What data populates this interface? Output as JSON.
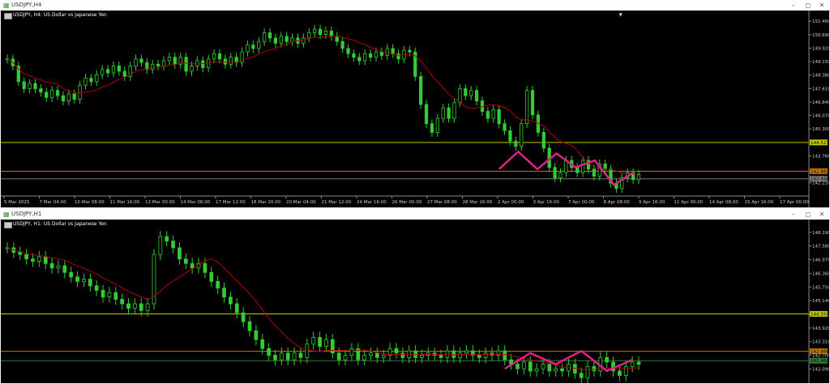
{
  "windows": [
    {
      "title": "USDJPY,H4",
      "chart_title": "USDJPY, H4: US Dollar vs Japanese Yen",
      "chart_data": {
        "type": "candlestick",
        "y_ticks": [
          151.46,
          150.69,
          149.92,
          149.15,
          148.38,
          147.61,
          146.84,
          146.07,
          145.3,
          143.76,
          142.22
        ],
        "ylim": [
          141.6,
          151.7
        ],
        "x_labels": [
          "5 Mar 2025",
          "7 Mar 04:00",
          "10 Mar 08:00",
          "11 Mar 16:00",
          "13 Mar 00:00",
          "14 Mar 08:00",
          "17 Mar 12:00",
          "18 Mar 20:00",
          "20 Mar 04:00",
          "21 Mar 12:00",
          "24 Mar 16:00",
          "26 Mar 00:00",
          "27 Mar 08:00",
          "28 Mar 16:00",
          "2 Apr 00:00",
          "3 Apr 16:00",
          "7 Apr 00:00",
          "8 Apr 08:00",
          "9 Apr 16:00",
          "11 Apr 00:00",
          "14 Apr 08:00",
          "15 Apr 16:00",
          "17 Apr 00:00"
        ],
        "closes": [
          149.3,
          148.9,
          148.0,
          147.6,
          147.9,
          147.6,
          147.4,
          147.1,
          147.5,
          147.2,
          146.9,
          147.3,
          147.0,
          147.8,
          148.2,
          148.0,
          148.4,
          148.7,
          148.5,
          148.9,
          148.6,
          148.3,
          148.9,
          149.3,
          149.1,
          148.7,
          149.0,
          148.9,
          149.2,
          149.4,
          149.0,
          149.4,
          148.6,
          148.9,
          149.2,
          148.8,
          149.3,
          149.6,
          149.3,
          149.0,
          149.4,
          149.1,
          149.7,
          150.1,
          149.9,
          150.3,
          150.8,
          150.5,
          150.2,
          150.6,
          150.3,
          150.5,
          150.2,
          150.5,
          150.8,
          151.0,
          150.7,
          150.9,
          150.6,
          150.3,
          149.9,
          149.6,
          149.4,
          149.2,
          149.6,
          149.4,
          149.7,
          149.5,
          149.9,
          149.6,
          149.3,
          149.8,
          149.7,
          148.3,
          146.7,
          145.6,
          145.1,
          145.9,
          146.5,
          145.9,
          146.8,
          147.6,
          147.2,
          147.5,
          146.9,
          146.3,
          145.9,
          146.4,
          145.6,
          145.2,
          144.6,
          144.3,
          145.6,
          147.5,
          146.1,
          145.1,
          144.2,
          143.1,
          142.5,
          142.8,
          143.5,
          143.1,
          142.8,
          143.5,
          143.0,
          142.6,
          143.3,
          143.0,
          142.2,
          141.9,
          142.5,
          142.8,
          142.4,
          142.7
        ],
        "indicator": "moving average",
        "levels": [
          {
            "label": "144.527",
            "value": 144.527,
            "color": "#c8c800"
          },
          {
            "label": "142.882",
            "value": 142.882,
            "color": "#c87800"
          },
          {
            "label": "142.448",
            "value": 142.448,
            "color": "#7a7a7a"
          }
        ],
        "pattern": [
          143.0,
          144.0,
          143.0,
          143.9,
          143.1,
          143.5,
          142.1,
          142.8
        ],
        "colors": {
          "up": "#33cc33",
          "down": "#33cc33",
          "ma": "#b00000",
          "pattern": "#e0208a"
        }
      }
    },
    {
      "title": "USDJPY,H1",
      "chart_title": "USDJPY, H1: US Dollar vs Japanese Yen",
      "chart_data": {
        "type": "candlestick",
        "y_ticks": [
          148.19,
          147.58,
          146.97,
          146.36,
          145.75,
          145.14,
          144.53,
          143.92,
          143.31,
          142.7,
          142.09
        ],
        "ylim": [
          141.6,
          148.4
        ],
        "x_labels": [],
        "closes": [
          147.5,
          147.3,
          147.2,
          147.0,
          146.9,
          147.1,
          146.8,
          146.6,
          146.7,
          146.4,
          146.2,
          146.0,
          146.1,
          145.8,
          145.6,
          145.3,
          145.5,
          145.2,
          145.0,
          144.8,
          145.0,
          144.7,
          145.0,
          147.2,
          148.0,
          147.8,
          147.5,
          147.0,
          146.8,
          146.6,
          146.8,
          146.4,
          146.0,
          145.7,
          145.3,
          145.0,
          144.6,
          144.2,
          143.8,
          143.4,
          143.0,
          142.7,
          142.5,
          142.8,
          142.5,
          142.8,
          142.6,
          143.2,
          143.5,
          143.1,
          143.4,
          142.8,
          142.5,
          142.7,
          143.0,
          142.5,
          142.7,
          142.8,
          142.6,
          142.7,
          143.0,
          142.8,
          142.6,
          142.9,
          142.6,
          142.7,
          142.8,
          142.7,
          142.6,
          142.9,
          142.6,
          142.8,
          142.9,
          142.7,
          142.6,
          142.8,
          142.7,
          142.9,
          142.5,
          142.3,
          142.1,
          142.4,
          142.0,
          142.1,
          142.3,
          142.0,
          142.1,
          142.0,
          142.3,
          141.9,
          141.7,
          142.2,
          142.0,
          142.6,
          142.4,
          142.0,
          141.8,
          142.2,
          142.4,
          142.3
        ],
        "indicator": "moving average",
        "levels": [
          {
            "label": "144.550",
            "value": 144.55,
            "color": "#c8c800"
          },
          {
            "label": "142.880",
            "value": 142.88,
            "color": "#c87800"
          },
          {
            "label": "142.460",
            "value": 142.46,
            "color": "#2e7d32"
          }
        ],
        "pattern": [
          142.1,
          142.8,
          142.3,
          142.9,
          142.0,
          142.5
        ],
        "colors": {
          "up": "#33cc33",
          "down": "#33cc33",
          "ma": "#b00000",
          "pattern": "#e0208a"
        }
      }
    }
  ],
  "controls": {
    "minimize": "–",
    "restore": "◻",
    "close": "✕"
  },
  "icons": {
    "app": "chart-candles-icon",
    "flag": "symbol-flag-icon"
  }
}
